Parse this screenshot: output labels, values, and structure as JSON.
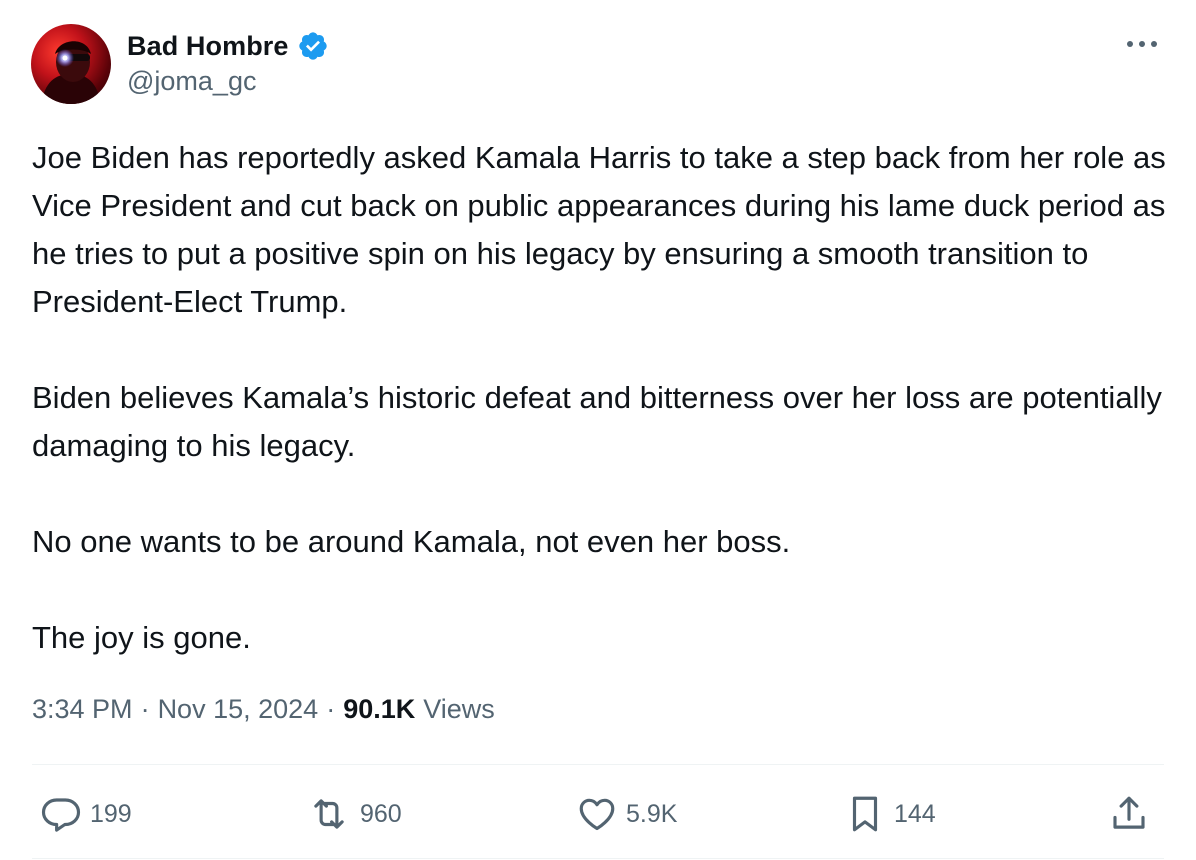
{
  "author": {
    "display_name": "Bad Hombre",
    "handle": "@joma_gc",
    "verified": true
  },
  "tweet": {
    "paragraphs": [
      "Joe Biden has reportedly asked Kamala Harris to take a step back from her role as Vice President and cut back on public appearances during his lame duck period as he tries to put a positive spin on his legacy by ensuring a smooth transition to President-Elect Trump.",
      "Biden believes Kamala’s historic defeat and bitterness over her loss are potentially damaging to his legacy.",
      "No one wants to be around Kamala, not even her boss.",
      "The joy is gone."
    ],
    "time": "3:34 PM",
    "separator": "·",
    "date": "Nov 15, 2024",
    "views_count": "90.1K",
    "views_label": "Views"
  },
  "actions": {
    "replies": "199",
    "reposts": "960",
    "likes": "5.9K",
    "bookmarks": "144"
  },
  "icons": {
    "verified": "verified-badge-icon",
    "more": "more-options-icon",
    "reply": "reply-icon",
    "repost": "repost-icon",
    "like": "heart-icon",
    "bookmark": "bookmark-icon",
    "share": "share-icon"
  },
  "colors": {
    "text_primary": "#0f1419",
    "text_secondary": "#536471",
    "verified_blue": "#1d9bf0",
    "divider": "#eff3f4"
  }
}
